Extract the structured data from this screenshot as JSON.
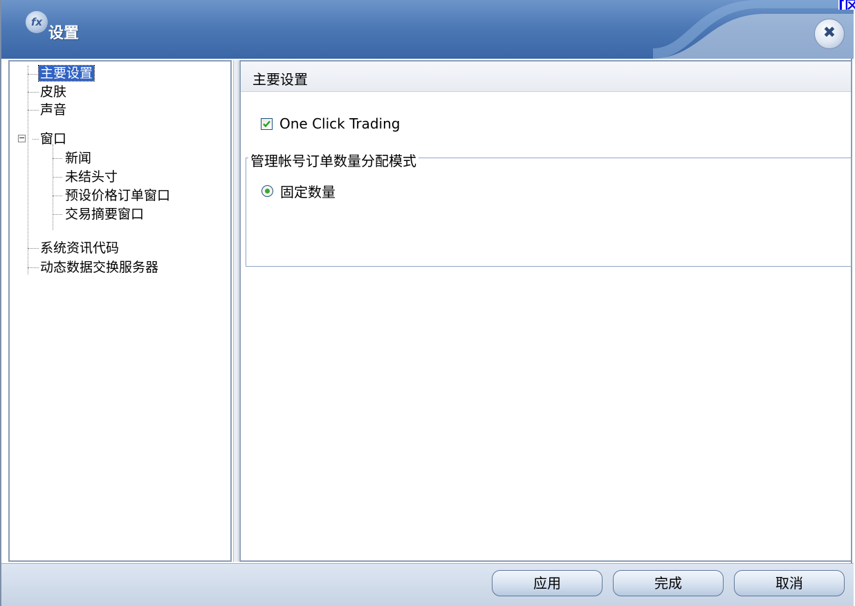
{
  "window": {
    "title": "设置",
    "corner_link": "[区",
    "logo_text": "fx"
  },
  "tree": {
    "items": [
      {
        "label": "主要设置",
        "selected": true
      },
      {
        "label": "皮肤"
      },
      {
        "label": "声音"
      },
      {
        "label": "窗口",
        "expander": "−"
      },
      {
        "label": "新闻"
      },
      {
        "label": "未结头寸"
      },
      {
        "label": "预设价格订单窗口"
      },
      {
        "label": "交易摘要窗口"
      },
      {
        "label": "系统资讯代码"
      },
      {
        "label": "动态数据交换服务器"
      }
    ]
  },
  "panel": {
    "title": "主要设置",
    "one_click": {
      "label": "One Click Trading",
      "checked": true
    },
    "group": {
      "legend": "管理帐号订单数量分配模式",
      "radio": {
        "label": "固定数量",
        "selected": true
      }
    }
  },
  "buttons": {
    "apply": "应用",
    "done": "完成",
    "cancel": "取消"
  },
  "colors": {
    "titlebar": "#4d79b6",
    "selection": "#3163c5",
    "check_green": "#3aa53a"
  }
}
